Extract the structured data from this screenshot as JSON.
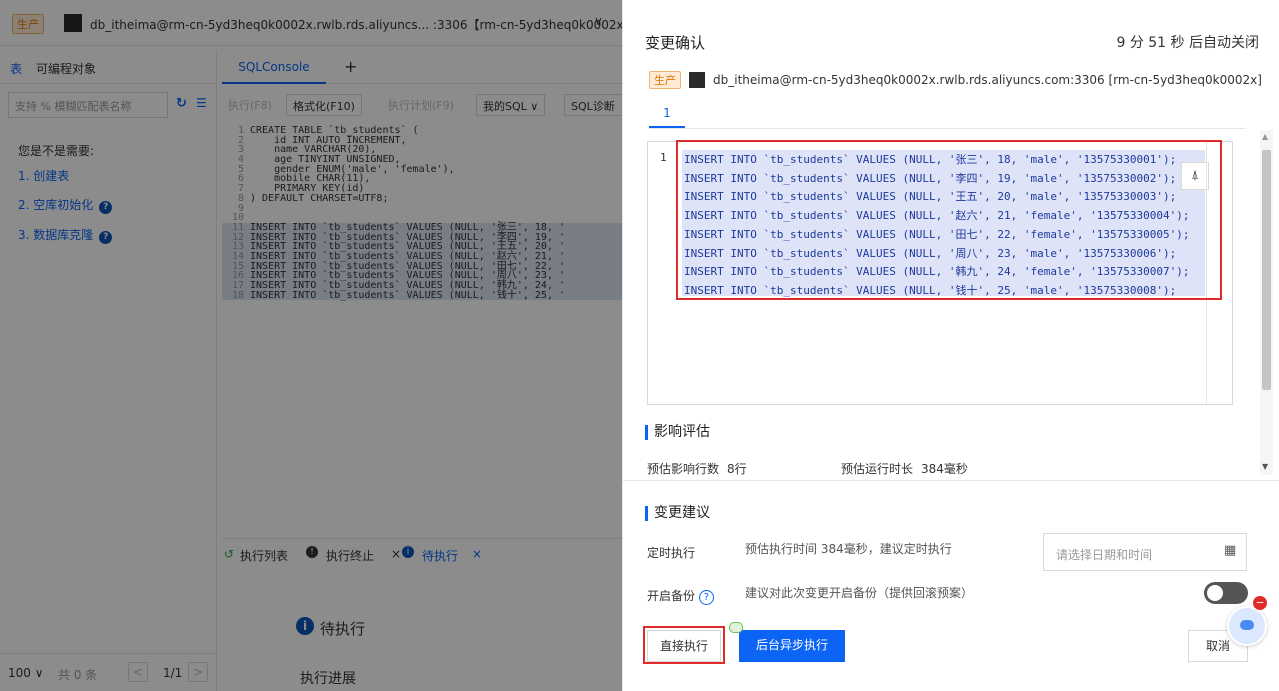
{
  "env_badge": "生产",
  "left": {
    "connection_title": "db_itheima@rm-cn-5yd3heq0k0002x.rwlb.rds.aliyuncs... :3306【rm-cn-5yd3heq0k0002x】",
    "sidebar_tabs": [
      "表",
      "可编程对象"
    ],
    "search_placeholder": "支持 % 模糊匹配表名称",
    "suggest_title": "您是不是需要:",
    "suggest_items": [
      "1. 创建表",
      "2. 空库初始化",
      "3. 数据库克隆"
    ],
    "editor_tab": "SQLConsole",
    "toolbar": {
      "execute": "执行(F8)",
      "format": "格式化(F10)",
      "plan": "执行计划(F9)",
      "my_sql": "我的SQL",
      "diagnose": "SQL诊断"
    },
    "code_lines": [
      {
        "n": "1",
        "text": "CREATE TABLE `tb_students` ("
      },
      {
        "n": "2",
        "text": "    id INT AUTO_INCREMENT,"
      },
      {
        "n": "3",
        "text": "    name VARCHAR(20),"
      },
      {
        "n": "4",
        "text": "    age TINYINT UNSIGNED,"
      },
      {
        "n": "5",
        "text": "    gender ENUM('male', 'female'),"
      },
      {
        "n": "6",
        "text": "    mobile CHAR(11),"
      },
      {
        "n": "7",
        "text": "    PRIMARY KEY(id)"
      },
      {
        "n": "8",
        "text": ") DEFAULT CHARSET=UTF8;"
      },
      {
        "n": "9",
        "text": ""
      },
      {
        "n": "10",
        "text": ""
      },
      {
        "n": "11",
        "text": "INSERT INTO `tb_students` VALUES (NULL, '张三', 18, '"
      },
      {
        "n": "12",
        "text": "INSERT INTO `tb_students` VALUES (NULL, '李四', 19, '"
      },
      {
        "n": "13",
        "text": "INSERT INTO `tb_students` VALUES (NULL, '王五', 20, '"
      },
      {
        "n": "14",
        "text": "INSERT INTO `tb_students` VALUES (NULL, '赵六', 21, '"
      },
      {
        "n": "15",
        "text": "INSERT INTO `tb_students` VALUES (NULL, '田七', 22, '"
      },
      {
        "n": "16",
        "text": "INSERT INTO `tb_students` VALUES (NULL, '周八', 23, '"
      },
      {
        "n": "17",
        "text": "INSERT INTO `tb_students` VALUES (NULL, '韩九', 24, '"
      },
      {
        "n": "18",
        "text": "INSERT INTO `tb_students` VALUES (NULL, '钱十', 25, '"
      }
    ],
    "bottom_tabs": {
      "exec_list": "执行列表",
      "exec_stop": "执行终止",
      "pending": "待执行"
    },
    "pending_title": "待执行",
    "progress_title": "执行进展",
    "pager": {
      "page_size": "100",
      "total": "共 0 条",
      "page": "1/1"
    }
  },
  "panel": {
    "title": "变更确认",
    "timer": "9 分 51 秒 后自动关闭",
    "connection": "db_itheima@rm-cn-5yd3heq0k0002x.rwlb.rds.aliyuncs.com:3306 [rm-cn-5yd3heq0k0002x]",
    "tab": "1",
    "sql_line_no": "1",
    "sql_lines": [
      "INSERT INTO `tb_students` VALUES (NULL, '张三', 18, 'male', '13575330001');",
      "INSERT INTO `tb_students` VALUES (NULL, '李四', 19, 'male', '13575330002');",
      "INSERT INTO `tb_students` VALUES (NULL, '王五', 20, 'male', '13575330003');",
      "INSERT INTO `tb_students` VALUES (NULL, '赵六', 21, 'female', '13575330004');",
      "INSERT INTO `tb_students` VALUES (NULL, '田七', 22, 'female', '13575330005');",
      "INSERT INTO `tb_students` VALUES (NULL, '周八', 23, 'male', '13575330006');",
      "INSERT INTO `tb_students` VALUES (NULL, '韩九', 24, 'female', '13575330007');",
      "INSERT INTO `tb_students` VALUES (NULL, '钱十', 25, 'male', '13575330008');"
    ],
    "impact_title": "影响评估",
    "rows_label": "预估影响行数",
    "rows_value": "8行",
    "duration_label": "预估运行时长",
    "duration_value": "384毫秒",
    "suggest_title": "变更建议",
    "scheduled_label": "定时执行",
    "scheduled_hint": "预估执行时间 384毫秒，建议定时执行",
    "date_placeholder": "请选择日期和时间",
    "backup_label": "开启备份",
    "backup_hint": "建议对此次变更开启备份（提供回滚预案）",
    "btn_direct": "直接执行",
    "btn_async": "后台异步执行",
    "btn_cancel": "取消"
  }
}
